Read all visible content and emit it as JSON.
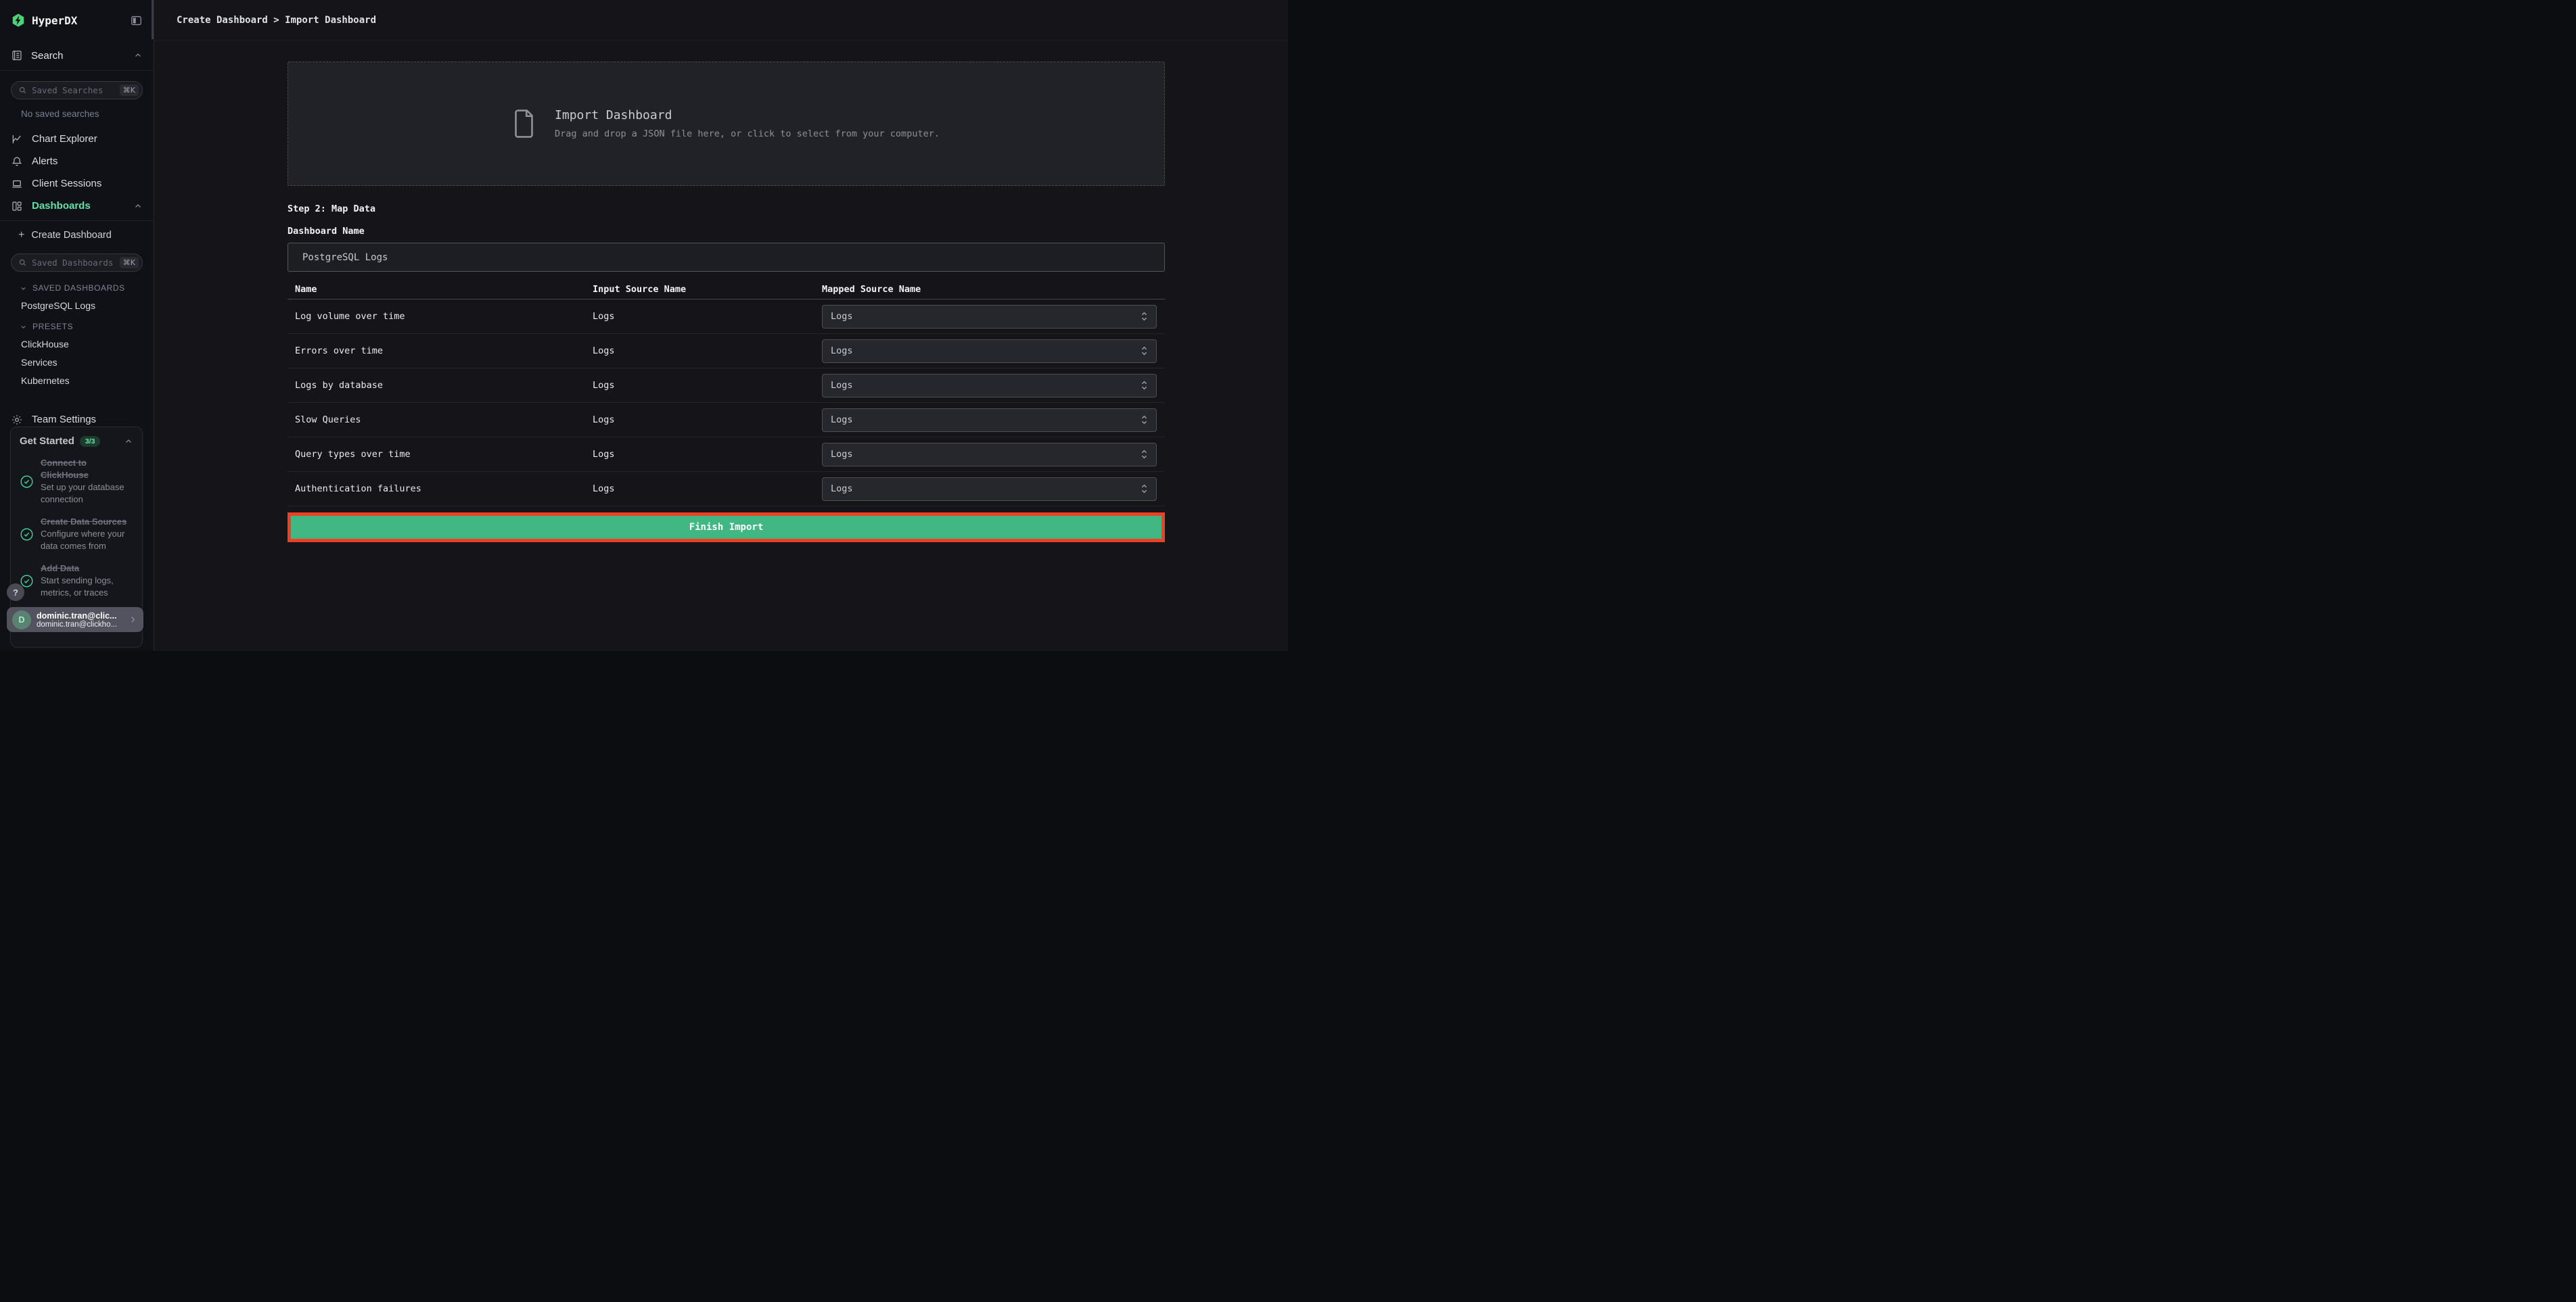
{
  "app": {
    "logo_text": "HyperDX"
  },
  "topbar": {
    "breadcrumb": "Create Dashboard > Import Dashboard"
  },
  "sidebar": {
    "search": {
      "header": "Search",
      "placeholder": "Saved Searches",
      "shortcut": "⌘K",
      "empty": "No saved searches"
    },
    "nav": [
      {
        "label": "Chart Explorer"
      },
      {
        "label": "Alerts"
      },
      {
        "label": "Client Sessions"
      },
      {
        "label": "Dashboards"
      }
    ],
    "create_dashboard": {
      "plus": "+",
      "label": "Create Dashboard"
    },
    "dashboards_search": {
      "placeholder": "Saved Dashboards",
      "shortcut": "⌘K"
    },
    "groups": [
      {
        "label": "SAVED DASHBOARDS",
        "items": [
          "PostgreSQL Logs"
        ]
      },
      {
        "label": "PRESETS",
        "items": [
          "ClickHouse",
          "Services",
          "Kubernetes"
        ]
      }
    ],
    "team_settings": "Team Settings",
    "get_started": {
      "title": "Get Started",
      "badge": "3/3",
      "items": [
        {
          "title": "Connect to ClickHouse",
          "desc": "Set up your database connection"
        },
        {
          "title": "Create Data Sources",
          "desc": "Configure where your data comes from"
        },
        {
          "title": "Add Data",
          "desc": "Start sending logs, metrics, or traces"
        }
      ]
    },
    "help": "?",
    "user": {
      "initial": "D",
      "name": "dominic.tran@clic...",
      "email": "dominic.tran@clickho..."
    }
  },
  "main": {
    "dropzone": {
      "title": "Import Dashboard",
      "subtitle": "Drag and drop a JSON file here, or click to select from your computer."
    },
    "step_label": "Step 2: Map Data",
    "name_field": {
      "label": "Dashboard Name",
      "value": "PostgreSQL Logs"
    },
    "table": {
      "columns": [
        "Name",
        "Input Source Name",
        "Mapped Source Name"
      ],
      "rows": [
        {
          "name": "Log volume over time",
          "input_source": "Logs",
          "mapped_source": "Logs"
        },
        {
          "name": "Errors over time",
          "input_source": "Logs",
          "mapped_source": "Logs"
        },
        {
          "name": "Logs by database",
          "input_source": "Logs",
          "mapped_source": "Logs"
        },
        {
          "name": "Slow Queries",
          "input_source": "Logs",
          "mapped_source": "Logs"
        },
        {
          "name": "Query types over time",
          "input_source": "Logs",
          "mapped_source": "Logs"
        },
        {
          "name": "Authentication failures",
          "input_source": "Logs",
          "mapped_source": "Logs"
        }
      ]
    },
    "finish_button": "Finish Import"
  },
  "colors": {
    "accent_green": "#61e2a8",
    "button_green": "#41b883",
    "annotation_red": "#ee4023",
    "badge_bg": "#1d3b2e",
    "badge_text": "#63e6ae"
  }
}
